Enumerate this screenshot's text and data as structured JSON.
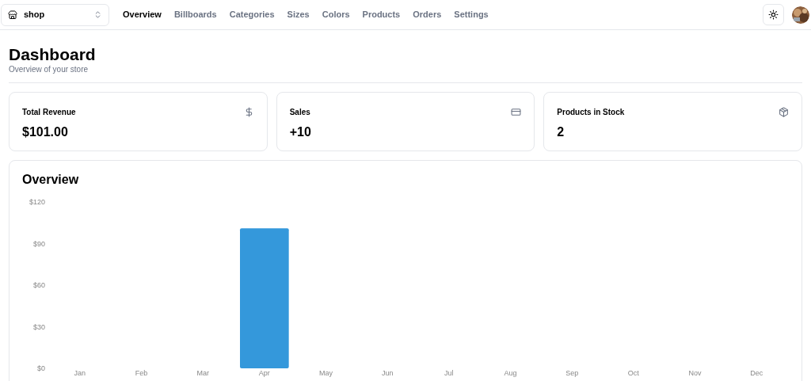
{
  "store_switcher": {
    "label": "shop"
  },
  "nav": [
    {
      "label": "Overview",
      "selected": true
    },
    {
      "label": "Billboards",
      "selected": false
    },
    {
      "label": "Categories",
      "selected": false
    },
    {
      "label": "Sizes",
      "selected": false
    },
    {
      "label": "Colors",
      "selected": false
    },
    {
      "label": "Products",
      "selected": false
    },
    {
      "label": "Orders",
      "selected": false
    },
    {
      "label": "Settings",
      "selected": false
    }
  ],
  "header": {
    "title": "Dashboard",
    "subtitle": "Overview of your store"
  },
  "stats": [
    {
      "kind": "dollar",
      "title": "Total Revenue",
      "value": "$101.00"
    },
    {
      "kind": "card",
      "title": "Sales",
      "value": "+10"
    },
    {
      "kind": "box",
      "title": "Products in Stock",
      "value": "2"
    }
  ],
  "overview": {
    "title": "Overview",
    "chart_data": {
      "type": "bar",
      "categories": [
        "Jan",
        "Feb",
        "Mar",
        "Apr",
        "May",
        "Jun",
        "Jul",
        "Aug",
        "Sep",
        "Oct",
        "Nov",
        "Dec"
      ],
      "series": [
        {
          "color": "#3498db",
          "values": [
            0,
            0,
            0,
            101,
            0,
            0,
            0,
            0,
            0,
            0,
            0,
            0
          ]
        }
      ],
      "ylim": [
        0,
        120
      ],
      "yticks": [
        {
          "value": 0,
          "label": "$0"
        },
        {
          "value": 30,
          "label": "$30"
        },
        {
          "value": 60,
          "label": "$60"
        },
        {
          "value": 90,
          "label": "$90"
        },
        {
          "value": 120,
          "label": "$120"
        }
      ]
    }
  }
}
